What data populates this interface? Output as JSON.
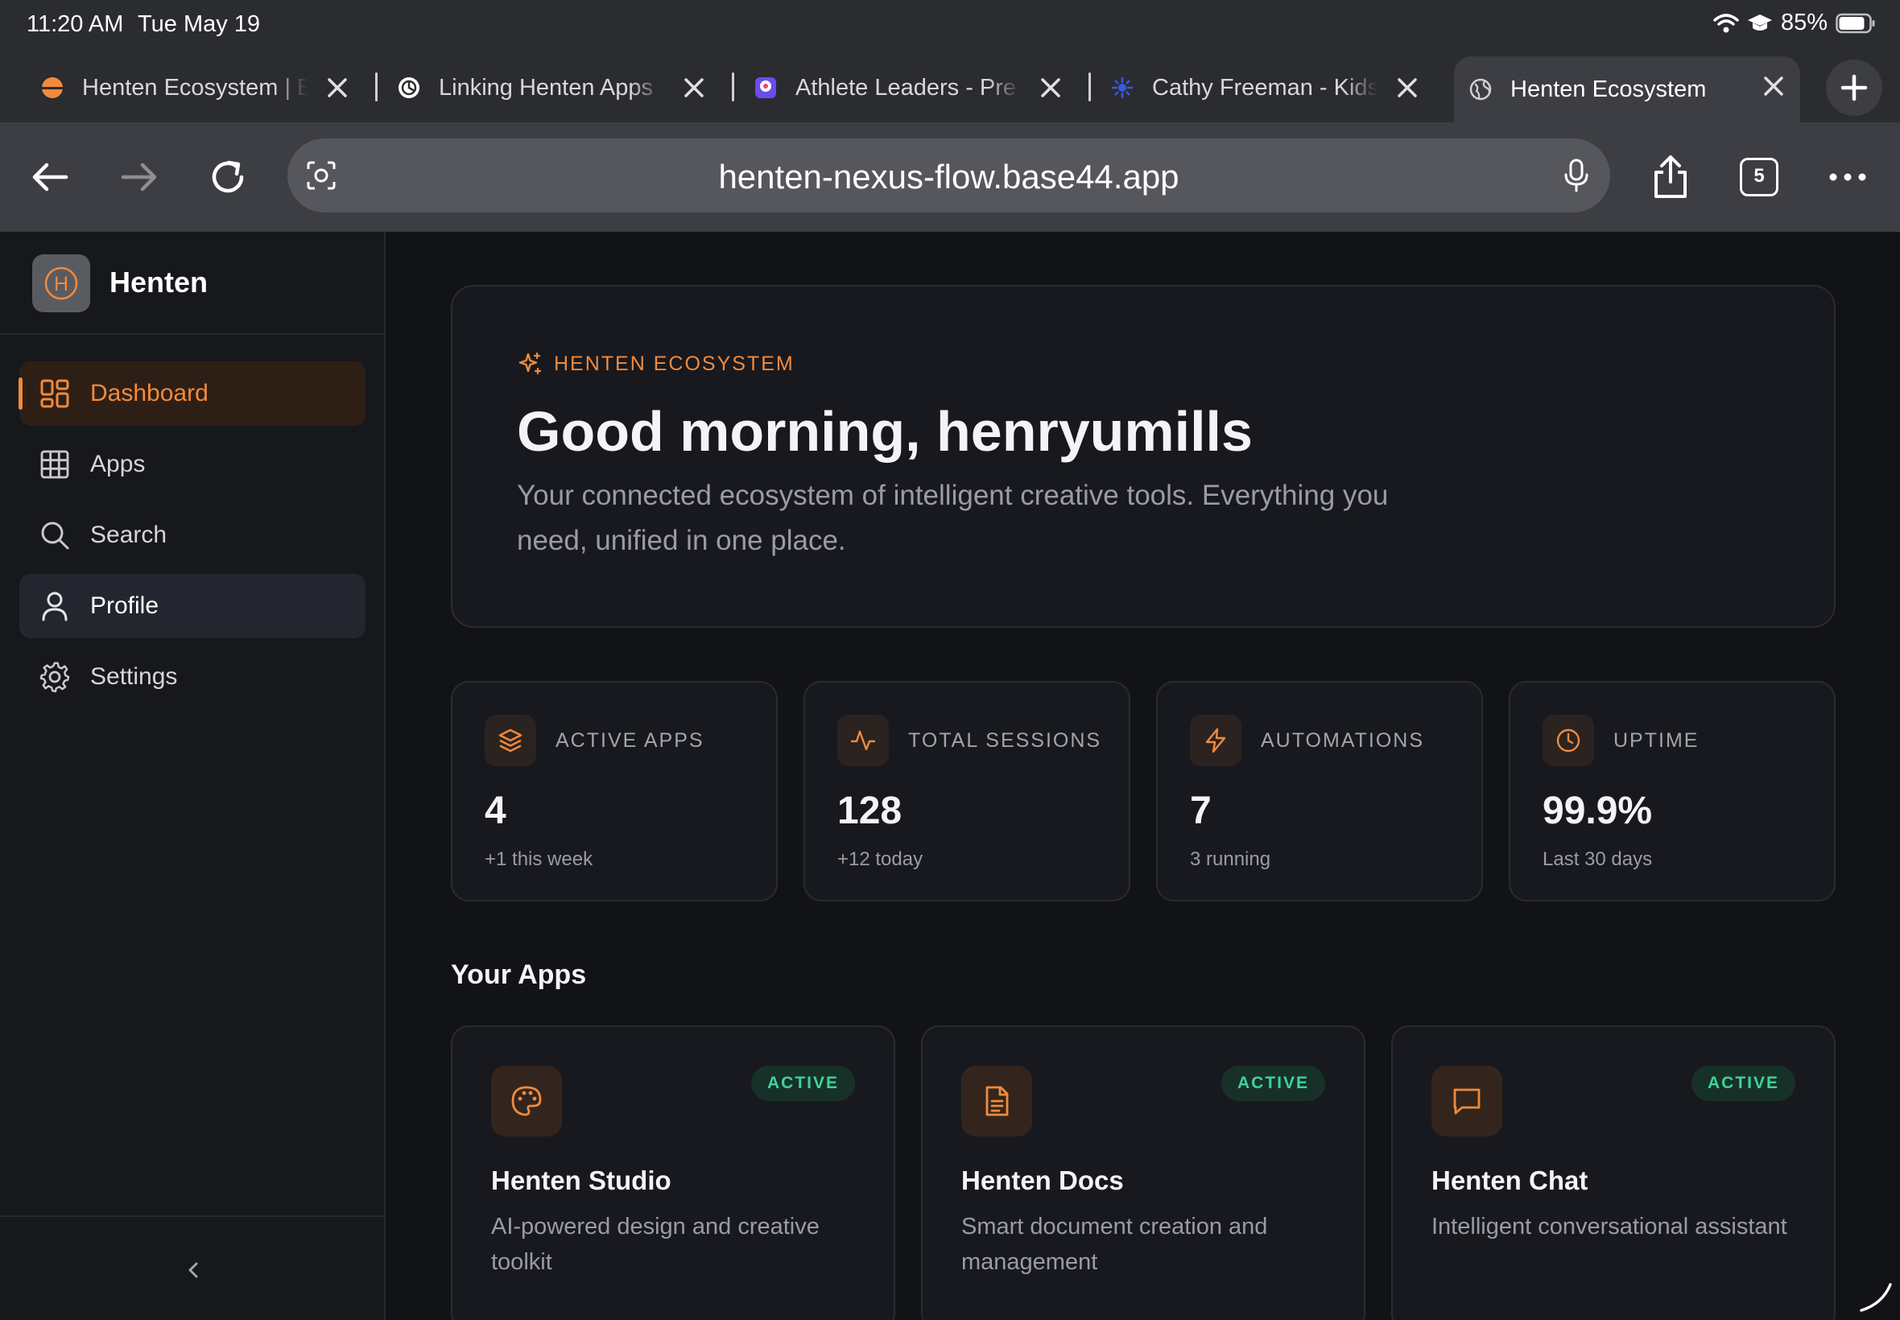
{
  "status": {
    "time": "11:20 AM",
    "date": "Tue May 19",
    "battery": "85%"
  },
  "tabs": [
    {
      "title": "Henten Ecosystem | B",
      "active": false
    },
    {
      "title": "Linking Henten Apps",
      "active": false
    },
    {
      "title": "Athlete Leaders - Pre",
      "active": false
    },
    {
      "title": "Cathy Freeman - Kids",
      "active": false
    },
    {
      "title": "Henten Ecosystem",
      "active": true
    }
  ],
  "toolbar": {
    "url": "henten-nexus-flow.base44.app",
    "tab_count": "5"
  },
  "sidebar": {
    "brand_initial": "H",
    "brand": "Henten",
    "items": [
      {
        "label": "Dashboard",
        "icon": "dashboard-icon",
        "state": "active"
      },
      {
        "label": "Apps",
        "icon": "grid-icon",
        "state": "normal"
      },
      {
        "label": "Search",
        "icon": "search-icon",
        "state": "normal"
      },
      {
        "label": "Profile",
        "icon": "user-icon",
        "state": "hovered"
      },
      {
        "label": "Settings",
        "icon": "gear-icon",
        "state": "normal"
      }
    ],
    "collapse_glyph": "‹"
  },
  "hero": {
    "eyebrow": "HENTEN ECOSYSTEM",
    "title": "Good morning, henryumills",
    "subtitle": "Your connected ecosystem of intelligent creative tools. Everything you need, unified in one place."
  },
  "stats": [
    {
      "label": "ACTIVE APPS",
      "value": "4",
      "note": "+1 this week",
      "icon": "layers-icon"
    },
    {
      "label": "TOTAL SESSIONS",
      "value": "128",
      "note": "+12 today",
      "icon": "activity-icon"
    },
    {
      "label": "AUTOMATIONS",
      "value": "7",
      "note": "3 running",
      "icon": "zap-icon"
    },
    {
      "label": "UPTIME",
      "value": "99.9%",
      "note": "Last 30 days",
      "icon": "clock-icon"
    }
  ],
  "apps_section_title": "Your Apps",
  "apps": [
    {
      "name": "Henten Studio",
      "desc": "AI-powered design and creative toolkit",
      "badge": "ACTIVE",
      "icon": "palette-icon"
    },
    {
      "name": "Henten Docs",
      "desc": "Smart document creation and management",
      "badge": "ACTIVE",
      "icon": "document-icon"
    },
    {
      "name": "Henten Chat",
      "desc": "Intelligent conversational assistant",
      "badge": "ACTIVE",
      "icon": "chat-icon"
    }
  ],
  "colors": {
    "accent": "#f28a3c",
    "active_badge_text": "#3ed39a",
    "background": "#121317",
    "card": "#18191e"
  }
}
